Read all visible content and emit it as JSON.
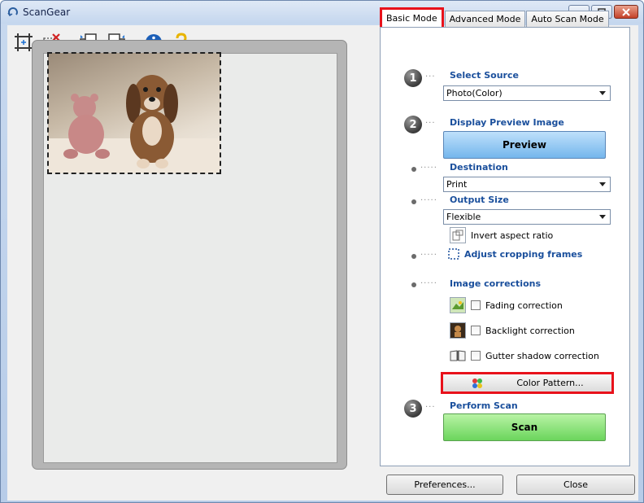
{
  "window": {
    "title": "ScanGear"
  },
  "toolbar": {
    "icons": [
      "crop-icon",
      "remove-crop-icon",
      "rotate-left-icon",
      "rotate-right-icon",
      "info-icon",
      "help-icon"
    ]
  },
  "tabs": [
    {
      "label": "Basic Mode",
      "active": true
    },
    {
      "label": "Advanced Mode",
      "active": false
    },
    {
      "label": "Auto Scan Mode",
      "active": false
    }
  ],
  "steps": {
    "select_source": {
      "number": "1",
      "label": "Select Source",
      "value": "Photo(Color)"
    },
    "display_preview": {
      "number": "2",
      "label": "Display Preview Image",
      "button": "Preview"
    },
    "destination": {
      "label": "Destination",
      "value": "Print"
    },
    "output_size": {
      "label": "Output Size",
      "value": "Flexible",
      "invert_label": "Invert aspect ratio"
    },
    "adjust_cropping": {
      "label": "Adjust cropping frames"
    },
    "image_corrections": {
      "label": "Image corrections",
      "items": [
        {
          "label": "Fading correction",
          "checked": false
        },
        {
          "label": "Backlight correction",
          "checked": false
        },
        {
          "label": "Gutter shadow correction",
          "checked": false
        }
      ],
      "color_pattern_button": "Color Pattern..."
    },
    "perform_scan": {
      "number": "3",
      "label": "Perform Scan",
      "button": "Scan"
    }
  },
  "footer": {
    "preferences": "Preferences...",
    "close": "Close"
  },
  "colors": {
    "highlight": "#e8121b",
    "preview_button": "#74b6ec",
    "scan_button": "#6bd55c",
    "section_label": "#1a4f9c"
  }
}
